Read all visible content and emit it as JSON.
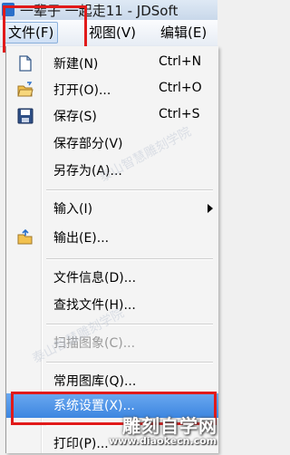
{
  "window": {
    "title": "一辈子 一起走11 - JDSoft"
  },
  "menubar": {
    "items": [
      {
        "label": "文件(F)"
      },
      {
        "label": "视图(V)"
      },
      {
        "label": "编辑(E)"
      }
    ]
  },
  "menu": {
    "items": [
      {
        "label": "新建(N)",
        "shortcut": "Ctrl+N",
        "icon": "new-document-icon",
        "enabled": true
      },
      {
        "label": "打开(O)...",
        "shortcut": "Ctrl+O",
        "icon": "open-folder-icon",
        "enabled": true
      },
      {
        "label": "保存(S)",
        "shortcut": "Ctrl+S",
        "icon": "save-floppy-icon",
        "enabled": true
      },
      {
        "label": "保存部分(V)",
        "shortcut": "",
        "enabled": true
      },
      {
        "label": "另存为(A)...",
        "shortcut": "",
        "enabled": true
      },
      {
        "label": "输入(I)",
        "shortcut": "",
        "submenu": true,
        "enabled": true
      },
      {
        "label": "输出(E)...",
        "shortcut": "",
        "icon": "export-folder-icon",
        "enabled": true
      },
      {
        "label": "文件信息(D)...",
        "shortcut": "",
        "enabled": true
      },
      {
        "label": "查找文件(H)...",
        "shortcut": "",
        "enabled": true
      },
      {
        "label": "扫描图象(C)...",
        "shortcut": "",
        "enabled": false
      },
      {
        "label": "常用图库(Q)...",
        "shortcut": "",
        "enabled": true
      },
      {
        "label": "系统设置(X)...",
        "shortcut": "",
        "enabled": true,
        "highlighted": true
      },
      {
        "label": "打印(P)...",
        "shortcut": "",
        "enabled": true
      }
    ]
  },
  "watermark": {
    "brand": "雕刻自学网",
    "url": "www.diaokecn.com",
    "overlay": "泰山智慧雕刻学院"
  },
  "colors": {
    "highlight_box": "#e11a1a",
    "selected_row": "#3d86e0"
  }
}
